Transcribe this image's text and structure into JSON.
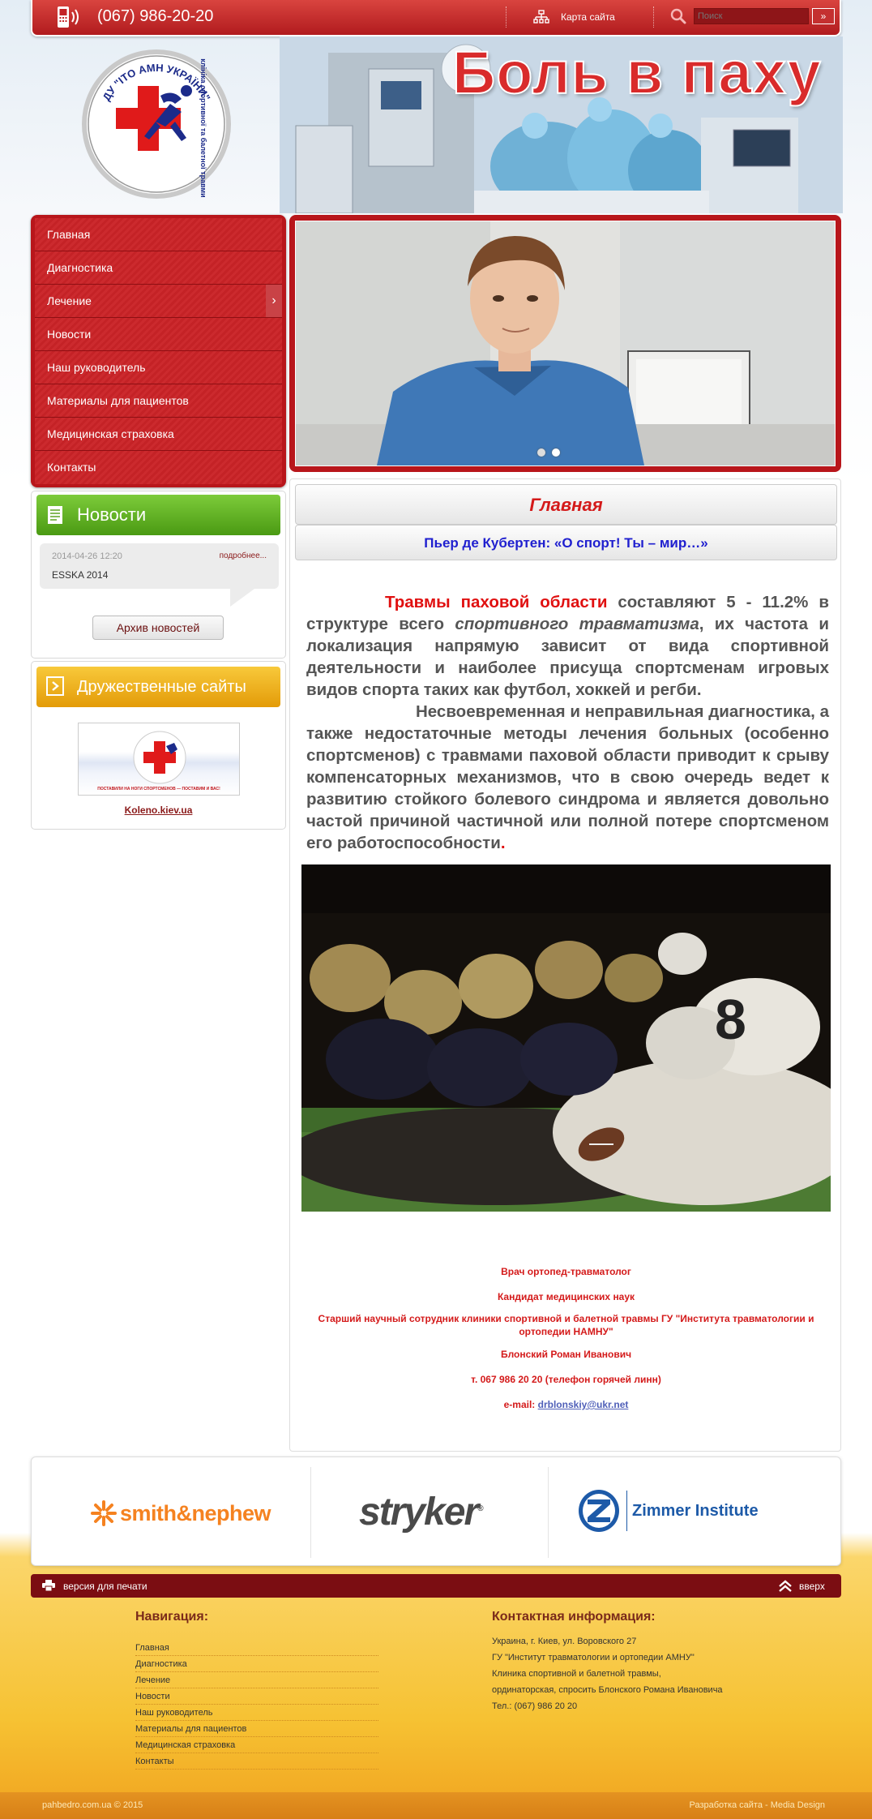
{
  "header": {
    "phone": "(067) 986-20-20",
    "sitemap_label": "Карта сайта",
    "search_placeholder": "Поиск",
    "search_button": "»"
  },
  "hero": {
    "title": "Боль в паху"
  },
  "logo": {
    "text_top": "ДУ \"ІТО АМН УКРАЇНИ\"",
    "text_side": "клініка спортивної та балетної травми"
  },
  "menu": {
    "items": [
      {
        "label": "Главная"
      },
      {
        "label": "Диагностика"
      },
      {
        "label": "Лечение",
        "has_submenu": true
      },
      {
        "label": "Новости"
      },
      {
        "label": "Наш руководитель"
      },
      {
        "label": "Материалы для пациентов"
      },
      {
        "label": "Медицинская страховка"
      },
      {
        "label": "Контакты"
      }
    ],
    "submenu_arrow": "›"
  },
  "news": {
    "header": "Новости",
    "items": [
      {
        "date": "2014-04-26 12:20",
        "more": "подробнее...",
        "title": "ESSKA 2014"
      }
    ],
    "archive_button": "Архив новостей"
  },
  "friends": {
    "header": "Дружественные сайты",
    "banner_caption": "ПОСТАВИЛИ НА НОГИ СПОРТСМЕНОВ — ПОСТАВИМ И ВАС!",
    "link": "Koleno.kiev.ua"
  },
  "content": {
    "page_title": "Главная",
    "quote": "Пьер де Кубертен: «О спорт! Ты – мир…»",
    "p1_red": "Травмы паховой области",
    "p1_a": " составляют 5 - 11.2% в структуре всего ",
    "p1_italic": "спортивного травматизма",
    "p1_b": ", их частота и локализация напрямую зависит от вида спортивной деятельности и наиболее присуща спортсменам игровых видов спорта таких как футбол, хоккей и регби.",
    "p2": "Несвоевременная и неправильная диагностика, а также недостаточные методы лечения больных (особенно спортсменов) с травмами паховой области приводит к срыву компенсаторных механизмов, что в свою очередь ведет к развитию стойкого болевого синдрома и является довольно частой причиной частичной или полной потере спортсменом его работоспособности",
    "p2_end": ".",
    "contact": {
      "line1": "Врач ортопед-травматолог",
      "line2": "Кандидат медицинских наук",
      "line3": "Старший научный сотрудник клиники спортивной и балетной травмы ГУ \"Института травматологии и ортопедии НАМНУ\"",
      "line4": "Блонский Роман Иванович",
      "line5": "т. 067 986 20 20 (телефон горячей линн)",
      "email_label": "e-mail: ",
      "email": "drblonskiy@ukr.net"
    }
  },
  "partners": [
    {
      "name": "smith&nephew",
      "color": "#f58220"
    },
    {
      "name": "stryker",
      "color": "#4a4a4a"
    },
    {
      "name": "Zimmer Institute",
      "color": "#1d5aa8"
    }
  ],
  "print_bar": {
    "print_label": "версия для печати",
    "up_label": "вверх"
  },
  "footer": {
    "nav_heading": "Навигация:",
    "nav_items": [
      "Главная",
      "Диагностика",
      "Лечение",
      "Новости",
      "Наш руководитель",
      "Материалы для пациентов",
      "Медицинская страховка",
      "Контакты"
    ],
    "contact_heading": "Контактная информация:",
    "contact_lines": [
      "Украина, г. Киев, ул. Воровского 27",
      "ГУ \"Институт травматологии и ортопедии АМНУ\"",
      "Клиника спортивной и балетной травмы,",
      "ординаторская, спросить Блонского Романа Ивановича",
      "Тел.: (067) 986 20 20"
    ],
    "copyright": "pahbedro.com.ua © 2015",
    "developer": "Разработка сайта - Media Design"
  },
  "colors": {
    "brand_red": "#b8161b",
    "news_green": "#5fb225",
    "friends_orange": "#f0b020",
    "quote_blue": "#1f1fcf"
  }
}
